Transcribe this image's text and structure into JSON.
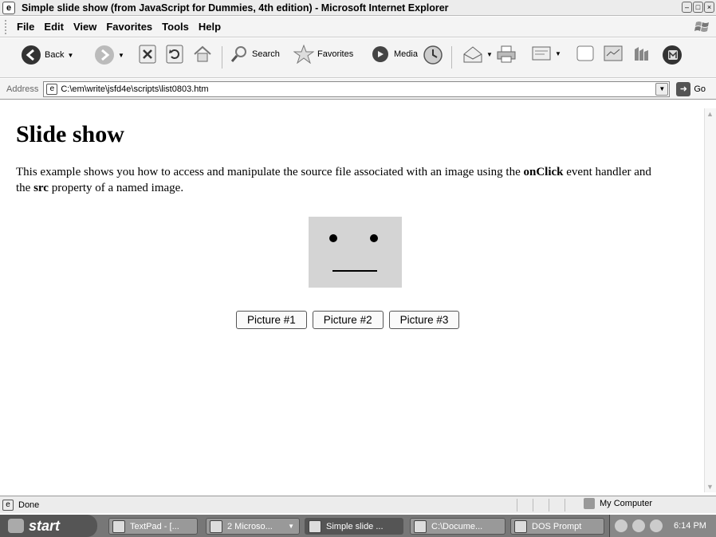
{
  "window": {
    "title": "Simple slide show (from JavaScript for Dummies, 4th edition) - Microsoft Internet Explorer",
    "app_icon": "ie-page-icon",
    "controls": [
      "minimize-icon",
      "maximize-icon",
      "close-icon"
    ]
  },
  "menu": {
    "items": [
      "File",
      "Edit",
      "View",
      "Favorites",
      "Tools",
      "Help"
    ]
  },
  "toolbar": {
    "back_label": "Back",
    "search_label": "Search",
    "favorites_label": "Favorites",
    "media_label": "Media"
  },
  "address": {
    "label": "Address",
    "value": "C:\\em\\write\\jsfd4e\\scripts\\list0803.htm",
    "go_label": "Go"
  },
  "page": {
    "heading": "Slide show",
    "intro_part1": "This example shows you how to access and manipulate the source file associated with an image using the ",
    "intro_bold1": "onClick",
    "intro_part2": " event handler and the ",
    "intro_bold2": "src",
    "intro_part3": " property of a named image.",
    "image": {
      "face_color": "#d4d4d4",
      "expression": "neutral"
    },
    "buttons": [
      "Picture #1",
      "Picture #2",
      "Picture #3"
    ]
  },
  "status": {
    "text": "Done",
    "zone": "My Computer"
  },
  "taskbar": {
    "start_label": "start",
    "tasks": [
      {
        "label": "TextPad - [...",
        "active": false
      },
      {
        "label": "2 Microso...",
        "active": false
      },
      {
        "label": "Simple slide ...",
        "active": true
      },
      {
        "label": "C:\\Docume...",
        "active": false
      },
      {
        "label": "DOS Prompt",
        "active": false
      }
    ],
    "clock": "6:14 PM"
  }
}
